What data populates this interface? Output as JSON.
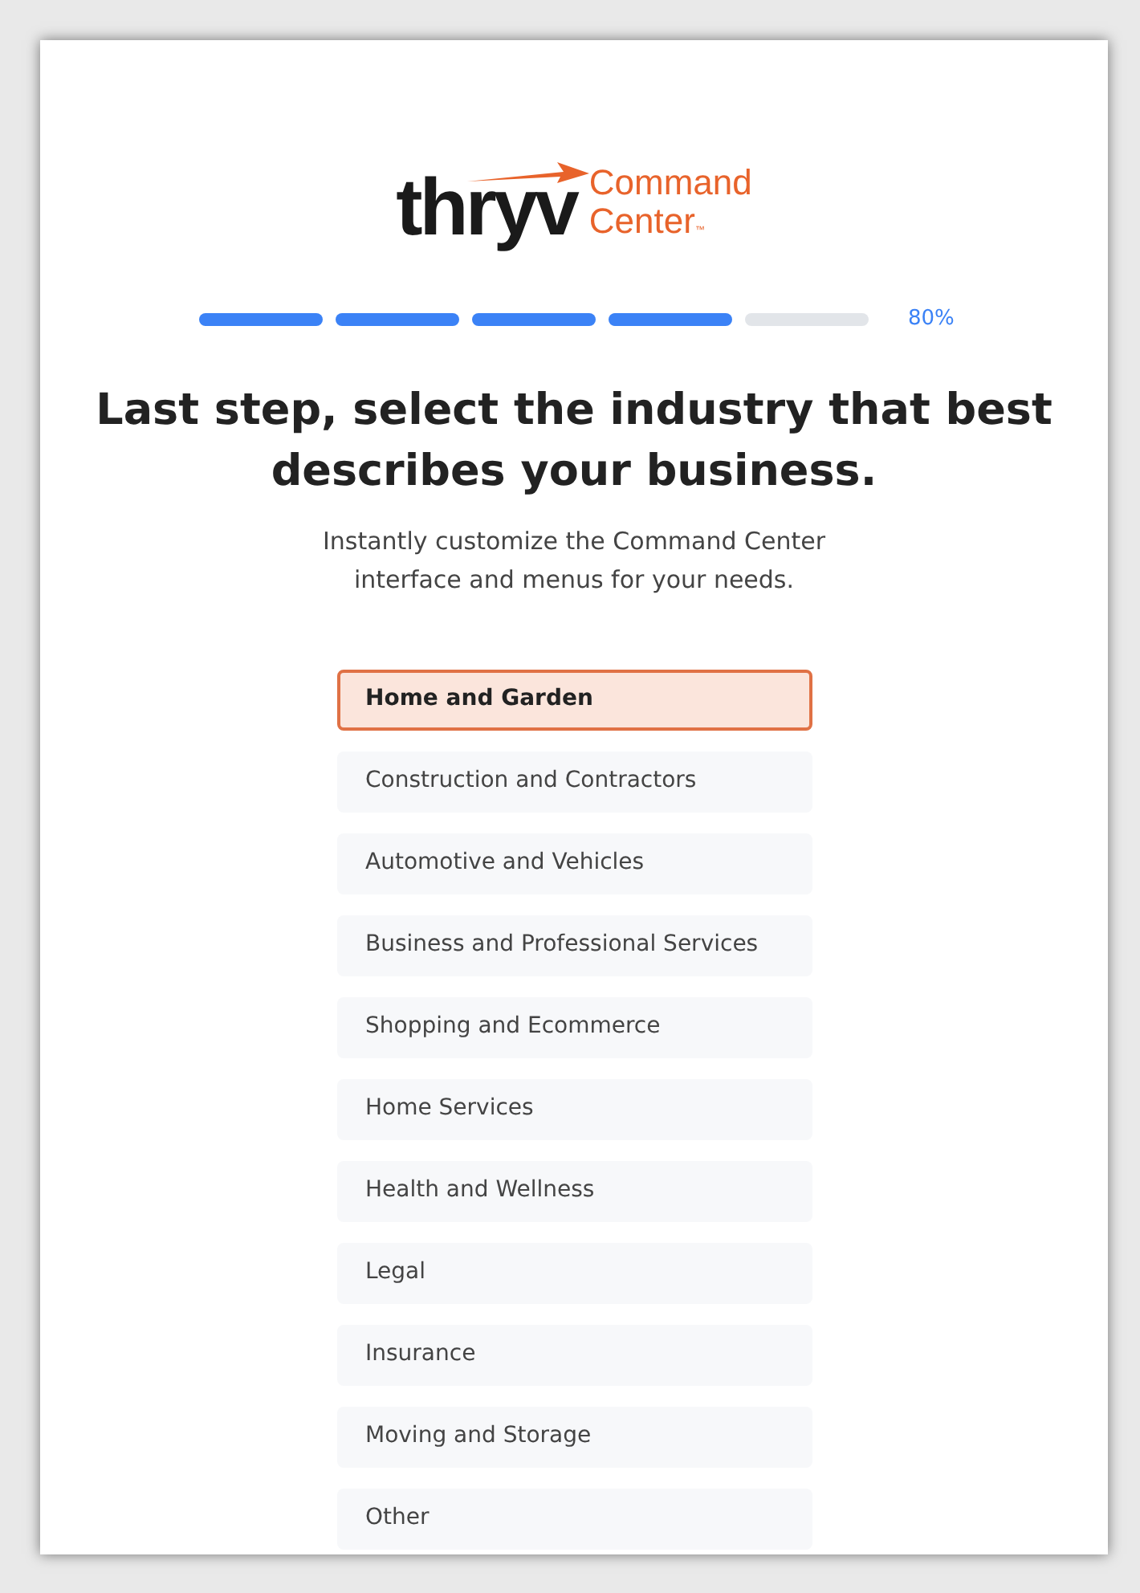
{
  "logo": {
    "brand": "thryv",
    "product_line_1": "Command",
    "product_line_2": "Center",
    "trademark": "™"
  },
  "progress": {
    "level": 0.8,
    "reading": "80%"
  },
  "heading": "Last step, select the industry that best describes your business.",
  "subtitle": "Instantly customize the Command Center interface and menus for your needs.",
  "industries": [
    {
      "label": "Home and Garden",
      "selected": true
    },
    {
      "label": "Construction and Contractors",
      "selected": false
    },
    {
      "label": "Automotive and Vehicles",
      "selected": false
    },
    {
      "label": "Business and Professional Services",
      "selected": false
    },
    {
      "label": "Shopping and Ecommerce",
      "selected": false
    },
    {
      "label": "Home Services",
      "selected": false
    },
    {
      "label": "Health and Wellness",
      "selected": false
    },
    {
      "label": "Legal",
      "selected": false
    },
    {
      "label": "Insurance",
      "selected": false
    },
    {
      "label": "Moving and Storage",
      "selected": false
    },
    {
      "label": "Other",
      "selected": false
    }
  ]
}
